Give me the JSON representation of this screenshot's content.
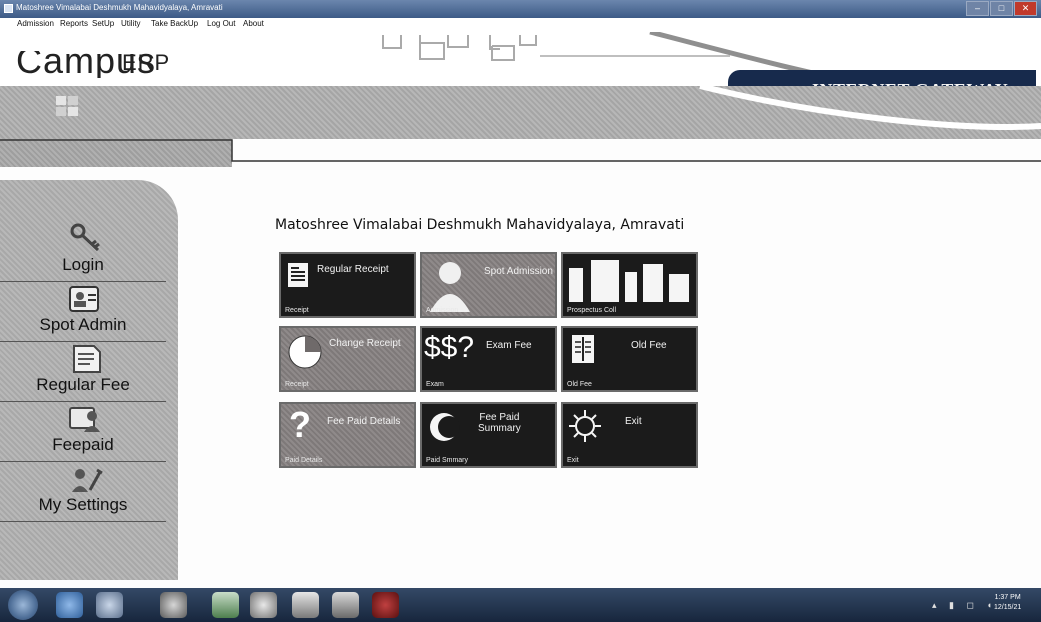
{
  "window": {
    "title": "Matoshree Vimalabai Deshmukh Mahavidyalaya, Amravati",
    "controls": [
      "–",
      "□",
      "✕"
    ]
  },
  "menu": [
    "Admission",
    "Reports",
    "SetUp",
    "Utility",
    "Take BackUp",
    "Log Out",
    "About"
  ],
  "header": {
    "logo_campus": "Campus",
    "logo_erp": "ERP",
    "gateway": "INTERNET GATEWAY"
  },
  "sidebar": {
    "items": [
      {
        "label": "Login",
        "icon": "key-icon"
      },
      {
        "label": "Spot Admin",
        "icon": "id-card-icon"
      },
      {
        "label": "Regular Fee",
        "icon": "document-icon"
      },
      {
        "label": "Feepaid",
        "icon": "users-icon"
      },
      {
        "label": "My Settings",
        "icon": "tools-icon"
      }
    ]
  },
  "main": {
    "title": "Matoshree Vimalabai Deshmukh Mahavidyalaya, Amravati",
    "tiles": [
      {
        "title": "Regular Receipt",
        "sub": "Receipt",
        "icon": "receipt-icon",
        "style": "dark"
      },
      {
        "title": "Spot Admission",
        "sub": "Admission",
        "icon": "person-icon",
        "style": "grey"
      },
      {
        "title": "",
        "sub": "Prospectus Coll",
        "icon": "bar-chart-icon",
        "style": "dark"
      },
      {
        "title": "Change Receipt",
        "sub": "Receipt",
        "icon": "pie-icon",
        "style": "grey"
      },
      {
        "title": "Exam Fee",
        "sub": "Exam",
        "icon": "dollar-icon",
        "glyph": "$$?",
        "style": "dark"
      },
      {
        "title": "Old Fee",
        "sub": "Old Fee",
        "icon": "book-icon",
        "style": "dark"
      },
      {
        "title": "Fee Paid Details",
        "sub": "Paid Details",
        "icon": "question-icon",
        "glyph": "?",
        "style": "grey"
      },
      {
        "title": "Fee Paid\nSummary",
        "sub": "Paid Smmary",
        "icon": "moon-icon",
        "style": "dark"
      },
      {
        "title": "Exit",
        "sub": "Exit",
        "icon": "sun-icon",
        "style": "dark"
      }
    ]
  },
  "taskbar": {
    "apps": [
      "ie-icon",
      "media-player-icon",
      "chrome-icon",
      "excel-icon",
      "browser-icon",
      "notes-icon",
      "paint-icon",
      "erp-icon"
    ],
    "time": "1:37 PM",
    "date": "12/15/21",
    "tray": "▴ ▮ ◻ ◖"
  }
}
